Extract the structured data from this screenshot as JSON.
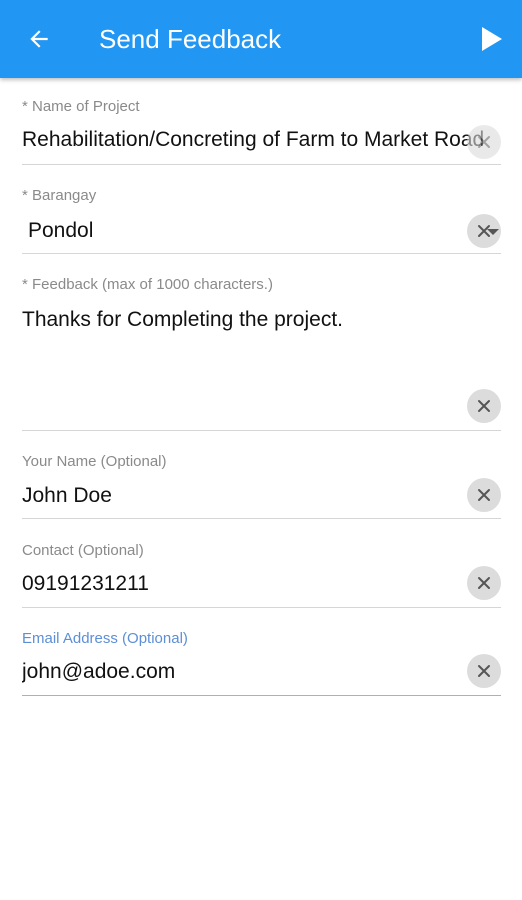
{
  "appbar": {
    "title": "Send Feedback",
    "back_icon": "arrow-back-icon",
    "send_icon": "send-play-icon",
    "color": "#2196f3"
  },
  "form": {
    "project": {
      "label": "* Name of Project",
      "value": "Rehabilitation/Concreting of Farm to Market Road"
    },
    "barangay": {
      "label": "* Barangay",
      "value": "Pondol"
    },
    "feedback": {
      "label": "* Feedback (max of 1000 characters.)",
      "value": "Thanks for Completing the project."
    },
    "name": {
      "label": "Your Name (Optional)",
      "value": "John Doe"
    },
    "contact": {
      "label": "Contact (Optional)",
      "value": "09191231211"
    },
    "email": {
      "label": "Email Address (Optional)",
      "value": "john@adoe.com",
      "focused": true,
      "focus_color": "#5c8fd6"
    }
  }
}
